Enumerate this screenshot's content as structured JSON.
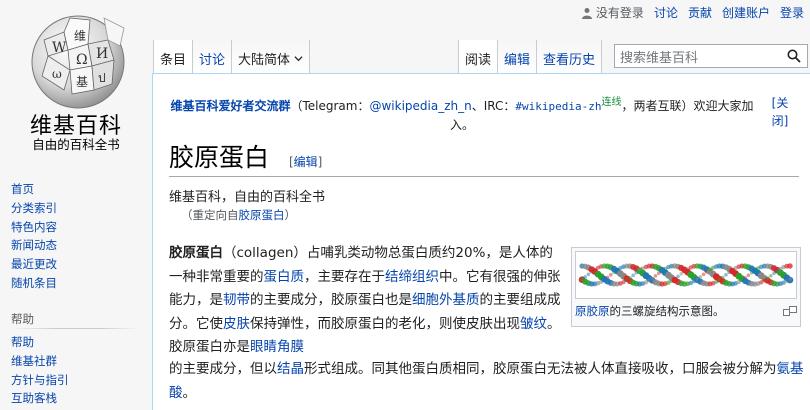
{
  "logo": {
    "wordmark": "维基百科",
    "tagline": "自由的百科全书"
  },
  "personal_tools": {
    "not_logged_in": "没有登录",
    "talk": "讨论",
    "contributions": "贡献",
    "create_account": "创建账户",
    "login": "登录"
  },
  "tabs": {
    "article": "条目",
    "talk": "讨论",
    "variant": "大陆简体",
    "read": "阅读",
    "edit": "编辑",
    "history": "查看历史"
  },
  "search": {
    "placeholder": "搜索维基百科"
  },
  "sitenotice": {
    "group_name": "维基百科爱好者交流群",
    "part1": "（Telegram：",
    "telegram_handle": "@wikipedia_zh_n",
    "part2": "、IRC：",
    "irc_channel": "#wikipedia-zh",
    "irc_suffix": "连线",
    "part3": "，两者互联）欢迎大家加入。",
    "dismiss": "[关闭]"
  },
  "page": {
    "title": "胶原蛋白",
    "edit_label": "编辑",
    "site_sub": "维基百科，自由的百科全书",
    "redirect_prefix": "（重定向自",
    "redirect_link": "胶原蛋白",
    "redirect_suffix": "）"
  },
  "thumbnail": {
    "caption_link": "原胶原",
    "caption_rest": "的三螺旋结构示意图。",
    "colors": [
      "#d62728",
      "#2ca02c",
      "#1f77b4",
      "#888888"
    ]
  },
  "intro": {
    "t1_bold": "胶原蛋白",
    "t2": "（collagen）占哺乳类动物总蛋白质约20%，是人体的一种非常重要的",
    "l1": "蛋白质",
    "t3": "，主要存在于",
    "l2": "结缔组织",
    "t4": "中。它有很强的伸张能力，是",
    "l3": "韧带",
    "t5": "的主要成分，胶原蛋白也是",
    "l4": "细胞外基质",
    "t6": "的主要组成成分。它使",
    "l5": "皮肤",
    "t7": "保持弹性，而胶原蛋白的老化，则使皮肤出现",
    "l6": "皱纹",
    "t8": "。胶原蛋白亦是",
    "l7": "眼睛",
    "l8": "角膜",
    "tail1": "的主要成分，但以",
    "l9": "结晶",
    "tail2": "形式组成。同其他蛋白质相同，胶原蛋白无法被人体直接吸收，口服会被分解为",
    "l10": "氨基酸",
    "tail3": "。"
  },
  "sidebar": {
    "main": [
      "首页",
      "分类索引",
      "特色内容",
      "新闻动态",
      "最近更改",
      "随机条目"
    ],
    "help_heading": "帮助",
    "help": [
      "帮助",
      "维基社群",
      "方针与指引",
      "互助客栈"
    ]
  }
}
